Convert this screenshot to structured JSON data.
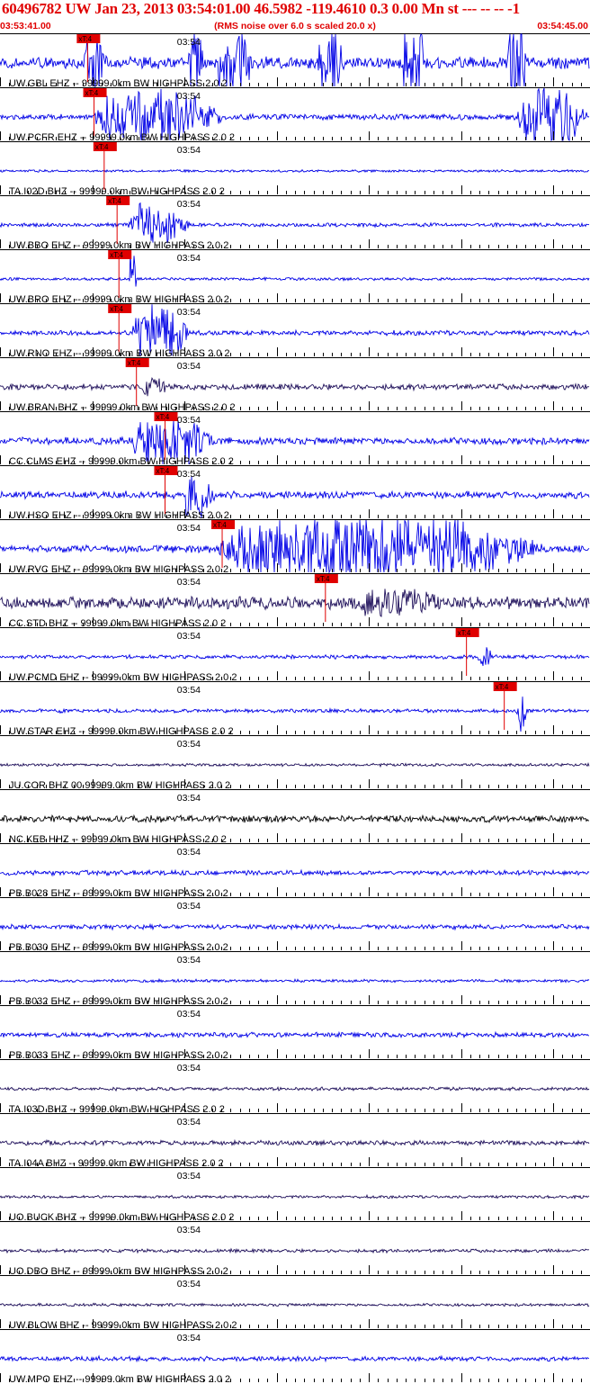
{
  "header": {
    "title": "60496782 UW Jan 23, 2013 03:54:01.00   46.5982 -119.4610  0.3 0.00 Mn st --- -- --  -1",
    "start_time": "03:53:41.00",
    "note": "(RMS noise over 6.0 s scaled 20.0 x)",
    "end_time": "03:54:45.00"
  },
  "chart_data": {
    "type": "seismogram",
    "x_range": [
      "03:53:41.00",
      "03:54:45.00"
    ],
    "minute_mark_label": "03:54",
    "minute_mark_seconds": 19,
    "pick_label": "xT:4",
    "colors": {
      "blue": "#0000e6",
      "purple": "#1e0f5a",
      "black": "#000000",
      "pick": "#e00000"
    },
    "traces": [
      {
        "label": "UW.GBL EHZ -- 99999.0km BW  HIGHPASS  2.0  2",
        "color": "blue",
        "noise": 0.25,
        "pick": 9.5,
        "bursts": [
          [
            9.0,
            11.7,
            1.8
          ],
          [
            20.4,
            22.2,
            1.8
          ],
          [
            23.4,
            27.7,
            1.8
          ],
          [
            34.4,
            37.5,
            1.8
          ],
          [
            43.6,
            46.5,
            1.8
          ],
          [
            55.0,
            57.5,
            1.8
          ]
        ]
      },
      {
        "label": "UW.PCFR EHZ -- 99999.0km BW  HIGHPASS  2.0  2",
        "color": "blue",
        "noise": 0.12,
        "pick": 10.2,
        "bursts": [
          [
            10.0,
            25.0,
            1.2
          ],
          [
            56.0,
            64.0,
            1.4
          ]
        ]
      },
      {
        "label": "TA.I02D BHZ -- 99999.0km BW  HIGHPASS  2.0  2",
        "color": "blue",
        "noise": 0.05,
        "pick": 11.3,
        "bursts": []
      },
      {
        "label": "UW.BBO EHZ -- 99999.0km BW  HIGHPASS  2.0  2",
        "color": "blue",
        "noise": 0.08,
        "pick": 12.7,
        "bursts": [
          [
            13.8,
            21.0,
            0.9
          ]
        ]
      },
      {
        "label": "UW.BRO EHZ -- 99999.0km BW  HIGHPASS  2.0  2",
        "color": "blue",
        "noise": 0.06,
        "pick": 12.9,
        "bursts": [
          [
            14.0,
            14.8,
            1.5
          ]
        ]
      },
      {
        "label": "UW.RNO EHZ -- 99999.0km BW  HIGHPASS  2.0  2",
        "color": "blue",
        "noise": 0.1,
        "pick": 12.9,
        "bursts": [
          [
            14.2,
            21.0,
            1.4
          ]
        ]
      },
      {
        "label": "UW.BRAN BHZ -- 99999.0km BW  HIGHPASS  2.0  2",
        "color": "purple",
        "noise": 0.12,
        "pick": 14.8,
        "bursts": [
          [
            15.0,
            18.5,
            0.4
          ]
        ]
      },
      {
        "label": "CC.CLMS EHZ -- 99999.0km BW  HIGHPASS  2.0  2",
        "color": "blue",
        "noise": 0.15,
        "pick": 17.9,
        "bursts": [
          [
            14.0,
            24.0,
            1.0
          ]
        ]
      },
      {
        "label": "UW.HSO EHZ -- 99999.0km BW  HIGHPASS  2.0  2",
        "color": "blue",
        "noise": 0.15,
        "pick": 17.9,
        "bursts": [
          [
            19.8,
            23.5,
            1.2
          ]
        ]
      },
      {
        "label": "UW.RVC EHZ -- 99999.0km BW  HIGHPASS  2.0  2",
        "color": "blue",
        "noise": 0.15,
        "pick": 24.1,
        "bursts": [
          [
            23.0,
            61.0,
            1.5
          ]
        ]
      },
      {
        "label": "CC.STD BHZ -- 99999.0km BW  HIGHPASS  2.0  2",
        "color": "purple",
        "noise": 0.25,
        "pick": 35.3,
        "bursts": [
          [
            38.0,
            50.0,
            0.6
          ]
        ]
      },
      {
        "label": "UW.PCMD EHZ -- 99999.0km BW  HIGHPASS  2.0  2",
        "color": "blue",
        "noise": 0.08,
        "pick": 50.6,
        "bursts": [
          [
            51.8,
            53.5,
            0.5
          ]
        ]
      },
      {
        "label": "UW.STAR EHZ -- 99999.0km BW  HIGHPASS  2.0  2",
        "color": "blue",
        "noise": 0.08,
        "pick": 54.7,
        "bursts": [
          [
            56.0,
            57.2,
            0.9
          ]
        ]
      },
      {
        "label": "JU.COR BHZ 00 99999.0km BW  HIGHPASS  2.0  2",
        "color": "purple",
        "noise": 0.06,
        "pick": null,
        "bursts": []
      },
      {
        "label": "NC.KEB HHZ -- 99999.0km BW  HIGHPASS  2.0  2",
        "color": "black",
        "noise": 0.14,
        "pick": null,
        "bursts": []
      },
      {
        "label": "PB.B028 EHZ -- 99999.0km BW  HIGHPASS  2.0  2",
        "color": "blue",
        "noise": 0.1,
        "pick": null,
        "bursts": []
      },
      {
        "label": "PB.B030 EHZ -- 99999.0km BW  HIGHPASS  2.0  2",
        "color": "blue",
        "noise": 0.1,
        "pick": null,
        "bursts": []
      },
      {
        "label": "PB.B032 EHZ -- 99999.0km BW  HIGHPASS  2.0  2",
        "color": "blue",
        "noise": 0.06,
        "pick": null,
        "bursts": []
      },
      {
        "label": "PB.B033 EHZ -- 99999.0km BW  HIGHPASS  2.0  2",
        "color": "blue",
        "noise": 0.1,
        "pick": null,
        "bursts": []
      },
      {
        "label": "TA.I03D BHZ -- 99999.0km BW  HIGHPASS  2.0  2",
        "color": "purple",
        "noise": 0.07,
        "pick": null,
        "bursts": []
      },
      {
        "label": "TA.I04A BHZ -- 99999.0km BW  HIGHPASS  2.0  2",
        "color": "purple",
        "noise": 0.1,
        "pick": null,
        "bursts": []
      },
      {
        "label": "UO.BUCK BHZ -- 99999.0km BW  HIGHPASS  2.0  2",
        "color": "purple",
        "noise": 0.06,
        "pick": null,
        "bursts": []
      },
      {
        "label": "UO.DBO BHZ -- 99999.0km BW  HIGHPASS  2.0  2",
        "color": "purple",
        "noise": 0.07,
        "pick": null,
        "bursts": []
      },
      {
        "label": "UW.BLOW BHZ -- 99999.0km BW  HIGHPASS  2.0  2",
        "color": "purple",
        "noise": 0.06,
        "pick": null,
        "bursts": []
      },
      {
        "label": "UW.MPO EHZ -- 99999.0km BW  HIGHPASS  2.0  2",
        "color": "blue",
        "noise": 0.1,
        "pick": null,
        "bursts": []
      }
    ]
  }
}
